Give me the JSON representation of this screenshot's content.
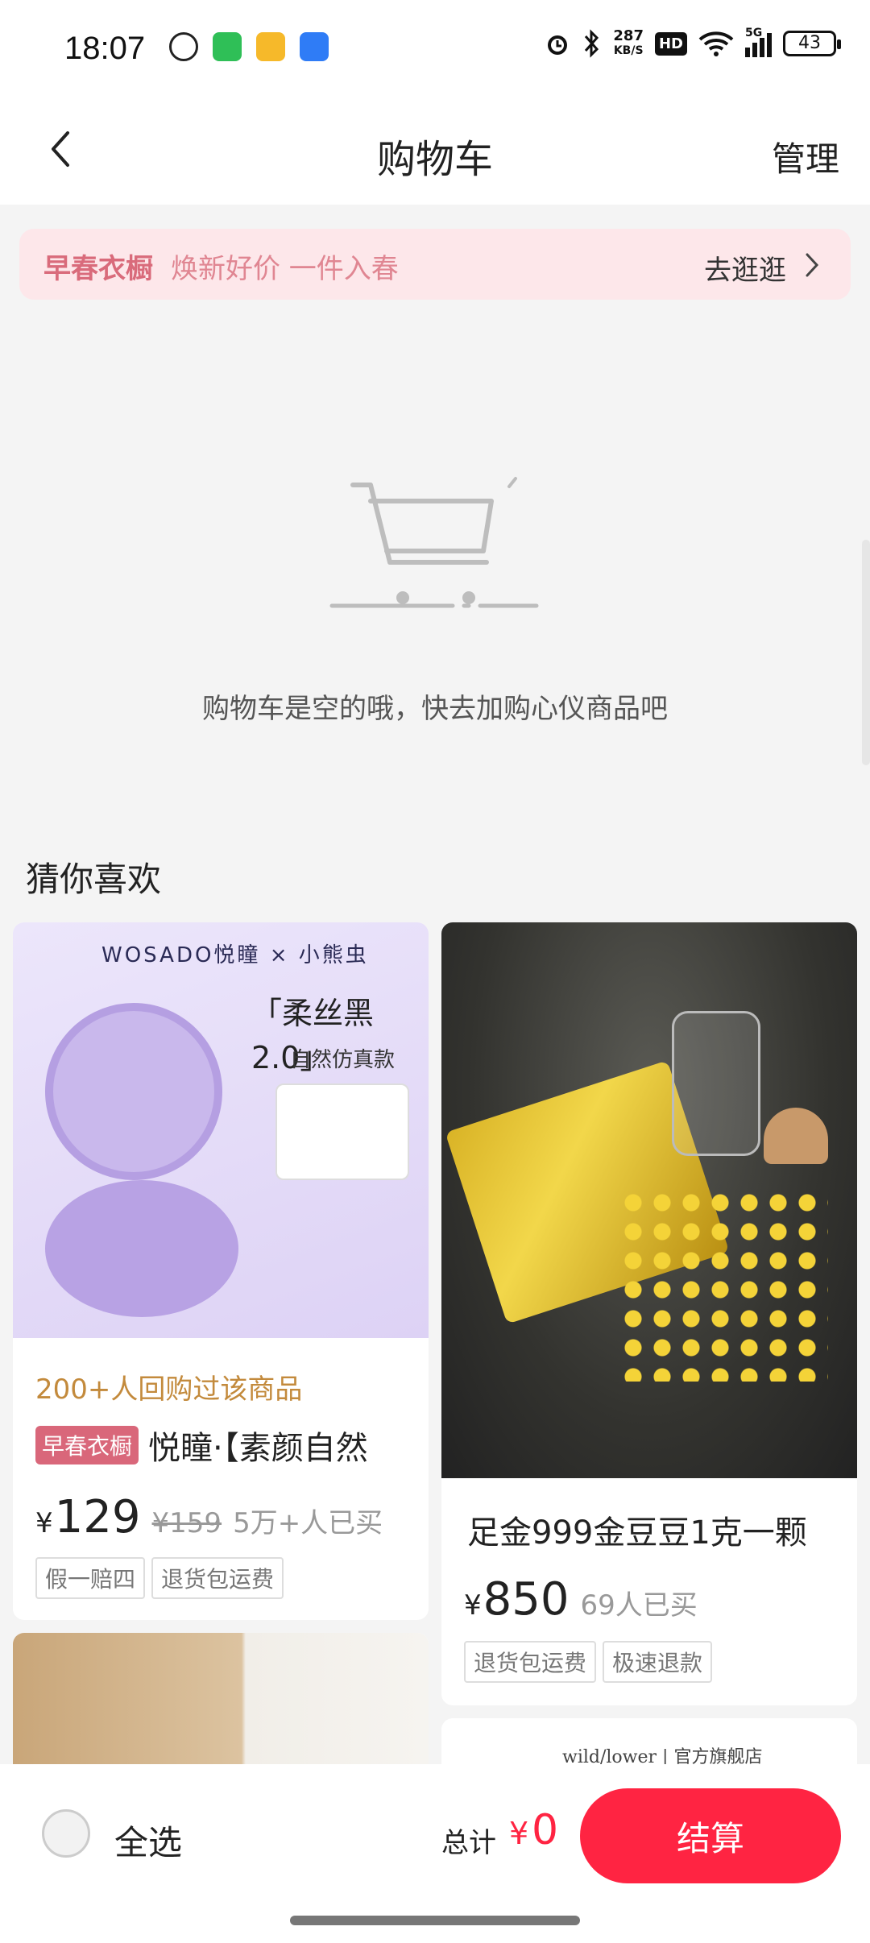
{
  "status_bar": {
    "time": "18:07",
    "app_icons": [
      {
        "name": "wechat-icon",
        "color": "#222222"
      },
      {
        "name": "messages-icon",
        "color": "#2fbf57"
      },
      {
        "name": "notes-icon",
        "color": "#f6b92a"
      },
      {
        "name": "security-icon",
        "color": "#2f7cf6"
      }
    ],
    "net_speed_value": "287",
    "net_speed_unit": "KB/S",
    "hd_label": "HD",
    "network": "5G",
    "battery": "43"
  },
  "header": {
    "title": "购物车",
    "manage_label": "管理"
  },
  "promo": {
    "tag": "早春衣橱",
    "text": "焕新好价 一件入春",
    "action": "去逛逛"
  },
  "empty_state": {
    "message": "购物车是空的哦，快去加购心仪商品吧"
  },
  "recommendations": {
    "section_title": "猜你喜欢",
    "items": [
      {
        "brand_text": "WOSADO悦瞳 × 小熊虫",
        "headline": "「柔丝黑2.0」",
        "sub": "自然仿真款",
        "bought_note": "200+人回购过该商品",
        "badge": "早春衣橱",
        "title": "悦瞳·【素颜自然",
        "currency": "¥",
        "price": "129",
        "old_price": "¥159",
        "sold": "5万+人已买",
        "tags": [
          "假一赔四",
          "退货包运费"
        ]
      },
      {
        "title": "足金999金豆豆1克一颗",
        "currency": "¥",
        "price": "850",
        "sold": "69人已买",
        "tags": [
          "退货包运费",
          "极速退款"
        ]
      },
      {
        "title": ""
      },
      {
        "header_text": "wild/lower | 官方旗舰店"
      }
    ]
  },
  "bottom_bar": {
    "select_all_label": "全选",
    "total_label": "总计",
    "currency": "¥",
    "total_value": "0",
    "checkout_label": "结算"
  },
  "colors": {
    "accent": "#ff2442",
    "promo_bg": "#fde7ea",
    "promo_tag": "#d96b7b",
    "bought_note": "#c38a3c"
  }
}
